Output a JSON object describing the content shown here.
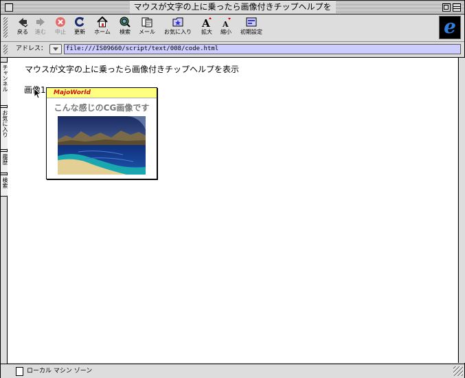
{
  "window": {
    "title": "マウスが文字の上に乗ったら画像付きチップヘルプを"
  },
  "toolbar": {
    "buttons": [
      {
        "label": "戻る",
        "icon": "back-arrow-icon",
        "enabled": true
      },
      {
        "label": "進む",
        "icon": "forward-arrow-icon",
        "enabled": false
      },
      {
        "label": "中止",
        "icon": "stop-icon",
        "enabled": false
      },
      {
        "label": "更新",
        "icon": "refresh-icon",
        "enabled": true
      },
      {
        "label": "ホーム",
        "icon": "home-icon",
        "enabled": true
      },
      {
        "label": "検索",
        "icon": "search-globe-icon",
        "enabled": true
      },
      {
        "label": "メール",
        "icon": "mail-icon",
        "enabled": true
      },
      {
        "label": "お気に入り",
        "icon": "favorites-icon",
        "enabled": true
      },
      {
        "label": "拡大",
        "icon": "text-larger-icon",
        "enabled": true
      },
      {
        "label": "縮小",
        "icon": "text-smaller-icon",
        "enabled": true
      },
      {
        "label": "初期設定",
        "icon": "preferences-icon",
        "enabled": true
      }
    ],
    "brand_letter": "e"
  },
  "address": {
    "label": "アドレス：",
    "url": "file:///IS09660/script/text/008/code.html"
  },
  "side_tabs": [
    "チャンネル",
    "お気に入り",
    "履歴",
    "検索"
  ],
  "page": {
    "heading": "マウスが文字の上に乗ったら画像付きチップヘルプを表示",
    "link_text": "画像1"
  },
  "tooltip": {
    "brand": "MajoWorld",
    "caption": "こんな感じのCG画像です"
  },
  "status": {
    "text": "ローカル マシン ゾーン"
  },
  "colors": {
    "address_bg": "#ccccff",
    "tooltip_header": "#ffff80",
    "brand_red": "#d01010",
    "ie_blue": "#2f7fe0"
  }
}
